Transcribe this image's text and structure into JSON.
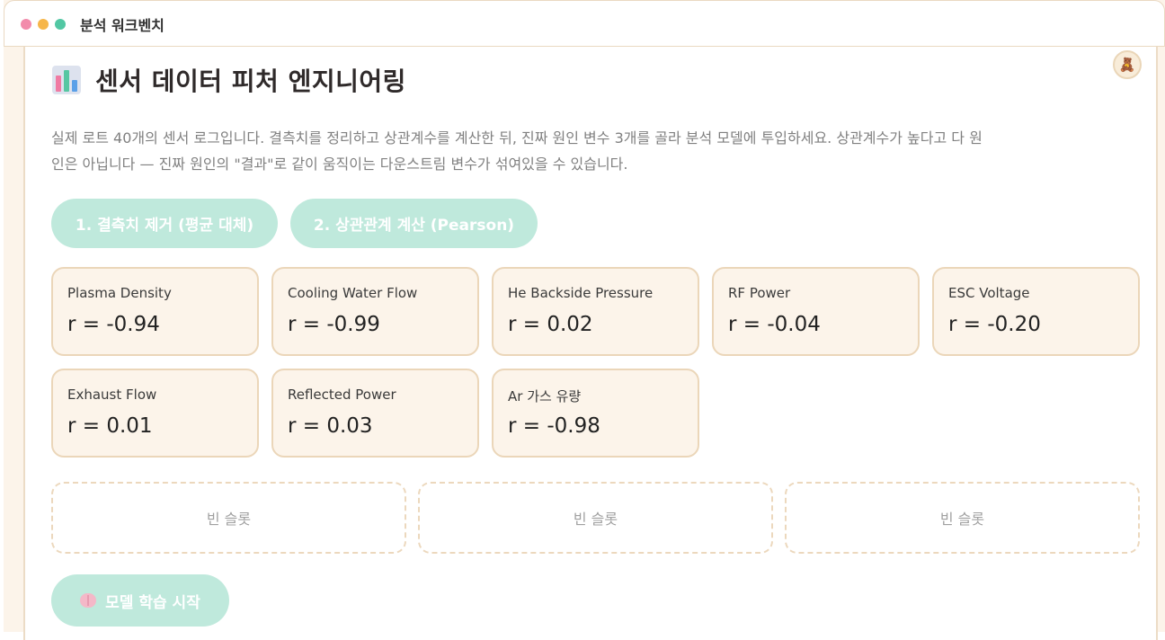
{
  "window": {
    "title": "분석 워크벤치"
  },
  "header": {
    "avatar_icon": "🧸",
    "title_icon": "bar-chart-icon",
    "title": "센서 데이터 피처 엔지니어링",
    "description_line1": "실제 로트 40개의 센서 로그입니다. 결측치를 정리하고 상관계수를 계산한 뒤, 진짜 원인 변수 3개를 골라 분석 모델에 투입하세요. 상관계수가 높다고 다 원",
    "description_line2": "인은 아닙니다 — 진짜 원인의 \"결과\"로 같이 움직이는 다운스트림 변수가 섞여있을 수 있습니다."
  },
  "actions": {
    "impute_label": "1. 결측치 제거 (평균 대체)",
    "correlate_label": "2. 상관관계 계산 (Pearson)"
  },
  "features": [
    {
      "name": "Plasma Density",
      "r": "r = -0.94"
    },
    {
      "name": "Cooling Water Flow",
      "r": "r = -0.99"
    },
    {
      "name": "He Backside Pressure",
      "r": "r = 0.02"
    },
    {
      "name": "RF Power",
      "r": "r = -0.04"
    },
    {
      "name": "ESC Voltage",
      "r": "r = -0.20"
    },
    {
      "name": "Exhaust Flow",
      "r": "r = 0.01"
    },
    {
      "name": "Reflected Power",
      "r": "r = 0.03"
    },
    {
      "name": "Ar 가스 유량",
      "r": "r = -0.98"
    }
  ],
  "slots": [
    {
      "label": "빈 슬롯"
    },
    {
      "label": "빈 슬롯"
    },
    {
      "label": "빈 슬롯"
    }
  ],
  "train": {
    "icon": "brain-icon",
    "label": "모델 학습 시작"
  },
  "colors": {
    "background": "#fcf4ea",
    "button_mint": "#bfe9dc",
    "card_border": "#ebd6b9",
    "dot_red": "#f28bab",
    "dot_yellow": "#f6b64a",
    "dot_green": "#52c7a3"
  }
}
